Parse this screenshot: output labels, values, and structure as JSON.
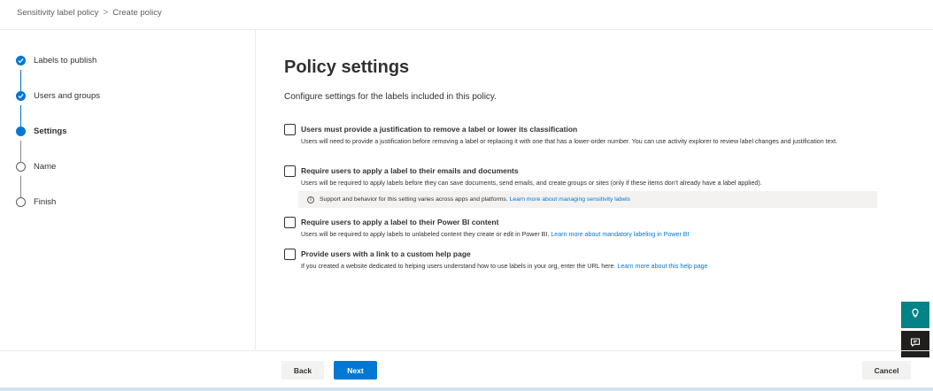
{
  "breadcrumb": {
    "parent": "Sensitivity label policy",
    "separator": ">",
    "current": "Create policy"
  },
  "steps": [
    {
      "label": "Labels to publish",
      "state": "done"
    },
    {
      "label": "Users and groups",
      "state": "done"
    },
    {
      "label": "Settings",
      "state": "current"
    },
    {
      "label": "Name",
      "state": "pending"
    },
    {
      "label": "Finish",
      "state": "pending"
    }
  ],
  "main": {
    "title": "Policy settings",
    "description": "Configure settings for the labels included in this policy."
  },
  "options": [
    {
      "title": "Users must provide a justification to remove a label or lower its classification",
      "description": "Users will need to provide a justification before removing a label or replacing it with one that has a lower-order number. You can use activity explorer to review label changes and justification text.",
      "link": "",
      "checked": false
    },
    {
      "title": "Require users to apply a label to their emails and documents",
      "description": "Users will be required to apply labels before they can save documents, send emails, and create groups or sites (only if these items don't already have a label applied).",
      "link": "",
      "checked": false
    },
    {
      "title": "Require users to apply a label to their Power BI content",
      "description": "Users will be required to apply labels to unlabeled content they create or edit in Power BI.",
      "link": "Learn more about mandatory labeling in Power BI",
      "checked": false
    },
    {
      "title": "Provide users with a link to a custom help page",
      "description": "If you created a website dedicated to helping users understand how to use labels in your org, enter the URL here.",
      "link": "Learn more about this help page",
      "checked": false
    }
  ],
  "info_bar": {
    "text": "Support and behavior for this setting varies across apps and platforms.",
    "link": "Learn more about managing sensitivity labels"
  },
  "footer": {
    "back_label": "Back",
    "next_label": "Next",
    "cancel_label": "Cancel"
  },
  "side_actions": {
    "help_icon": "lightbulb-icon",
    "feedback_icon": "feedback-icon"
  },
  "colors": {
    "accent": "#0078d4",
    "help_button": "#038387",
    "feedback_button": "#201f1e"
  }
}
